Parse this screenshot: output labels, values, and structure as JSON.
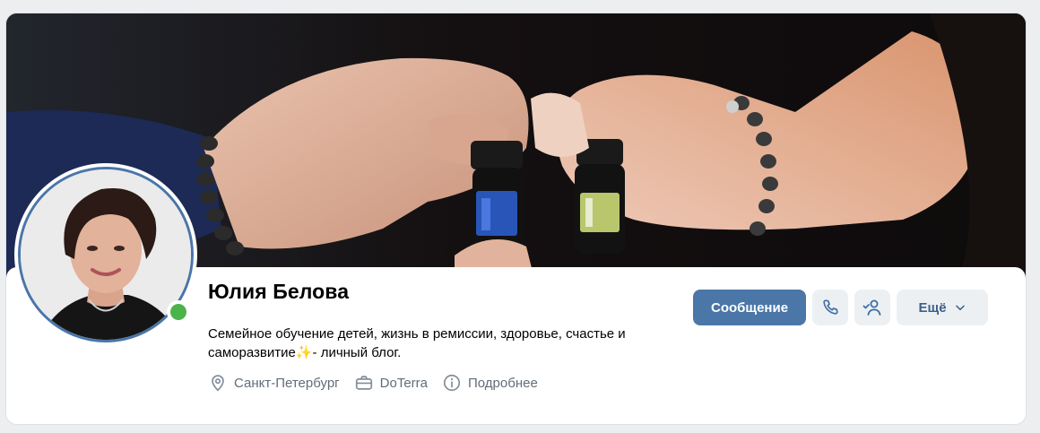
{
  "profile": {
    "name": "Юлия Белова",
    "status_text": "Семейное обучение детей, жизнь в ремиссии, здоровье, счастье и саморазвитие",
    "status_emoji": "✨",
    "status_suffix": "- личный блог.",
    "online": true
  },
  "meta": {
    "city": "Санкт-Петербург",
    "work": "DoTerra",
    "more": "Подробнее"
  },
  "actions": {
    "message_label": "Сообщение",
    "more_label": "Ещё"
  },
  "icons": {
    "city": "location-pin-icon",
    "work": "briefcase-icon",
    "more": "info-icon",
    "call": "phone-icon",
    "friend": "user-check-icon",
    "dropdown": "chevron-down-icon"
  },
  "colors": {
    "accent": "#4a76a8",
    "online": "#4bb34b",
    "meta_text": "#626d7a",
    "page_bg": "#edeef0"
  }
}
